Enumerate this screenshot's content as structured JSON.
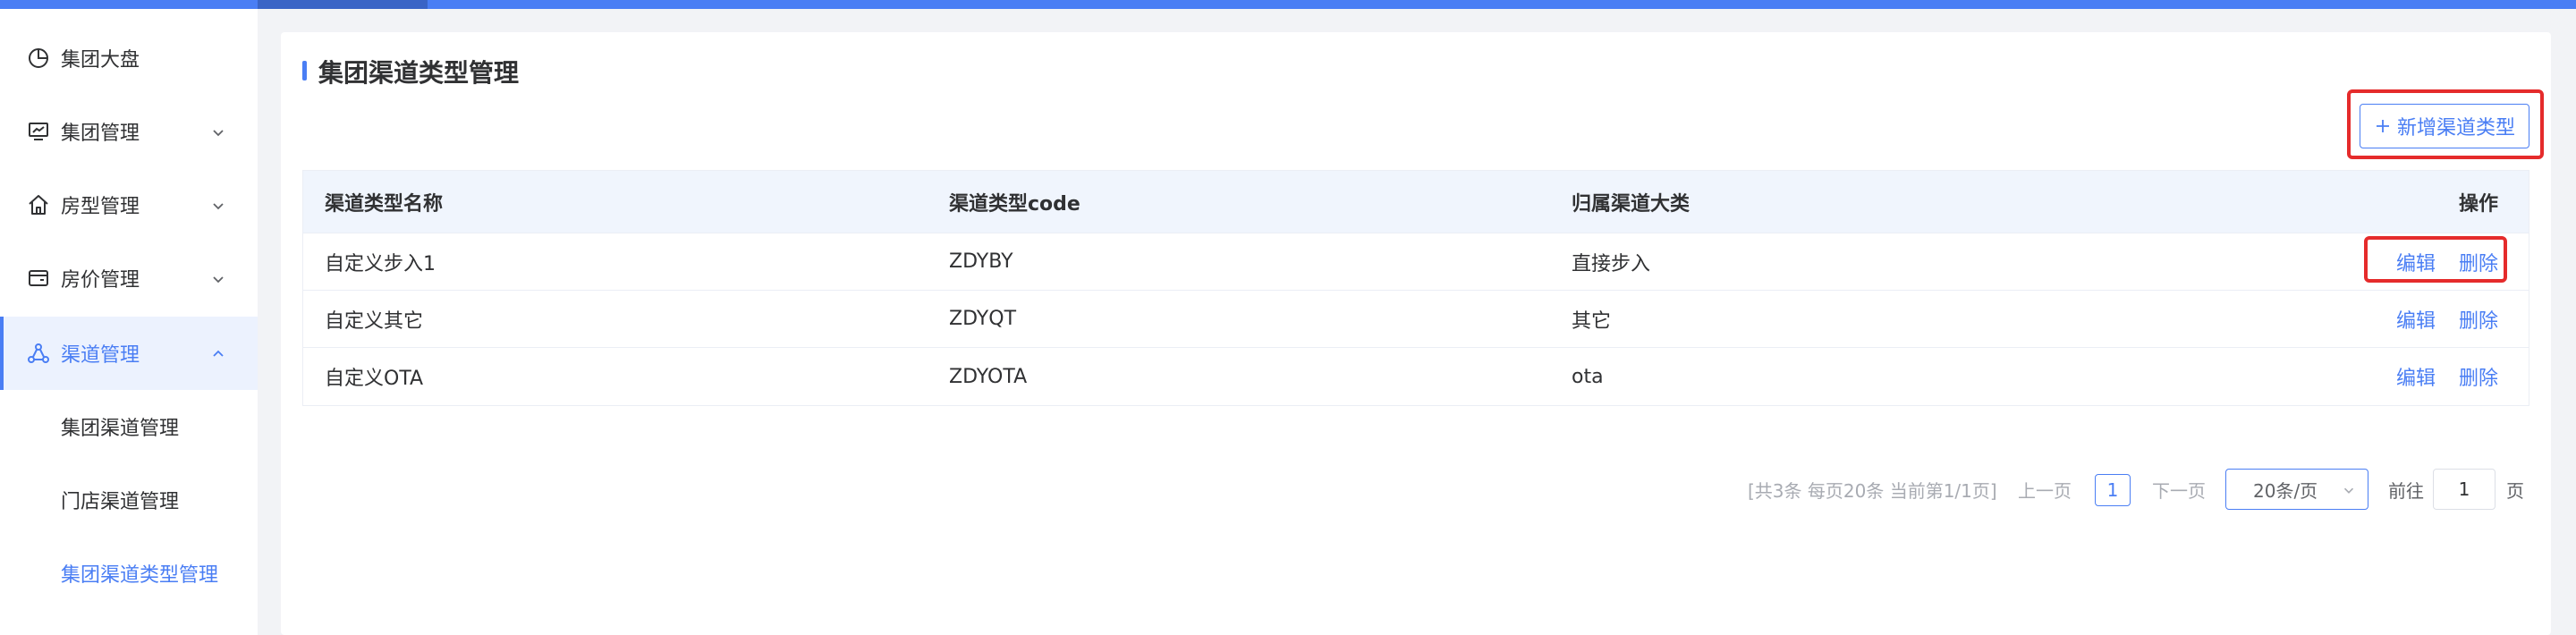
{
  "sidebar": {
    "items": [
      {
        "label": "集团大盘",
        "icon": "pie-chart-icon"
      },
      {
        "label": "集团管理",
        "icon": "monitor-chart-icon"
      },
      {
        "label": "房型管理",
        "icon": "home-icon"
      },
      {
        "label": "房价管理",
        "icon": "wallet-icon"
      },
      {
        "label": "渠道管理",
        "icon": "share-nodes-icon"
      }
    ],
    "sub_items": [
      {
        "label": "集团渠道管理"
      },
      {
        "label": "门店渠道管理"
      },
      {
        "label": "集团渠道类型管理"
      }
    ]
  },
  "page": {
    "title": "集团渠道类型管理",
    "add_button": "新增渠道类型"
  },
  "table": {
    "headers": [
      "渠道类型名称",
      "渠道类型code",
      "归属渠道大类",
      "操作"
    ],
    "rows": [
      {
        "name": "自定义步入1",
        "code": "ZDYBY",
        "category": "直接步入",
        "edit": "编辑",
        "delete": "删除"
      },
      {
        "name": "自定义其它",
        "code": "ZDYQT",
        "category": "其它",
        "edit": "编辑",
        "delete": "删除"
      },
      {
        "name": "自定义OTA",
        "code": "ZDYOTA",
        "category": "ota",
        "edit": "编辑",
        "delete": "删除"
      }
    ]
  },
  "pagination": {
    "total_text": "[共3条 每页20条 当前第1/1页]",
    "prev": "上一页",
    "current_page": "1",
    "next": "下一页",
    "page_size": "20条/页",
    "goto_label": "前往",
    "goto_value": "1",
    "page_suffix": "页"
  },
  "colors": {
    "accent": "#4a7ef4",
    "highlight_box": "#e52b2b"
  }
}
